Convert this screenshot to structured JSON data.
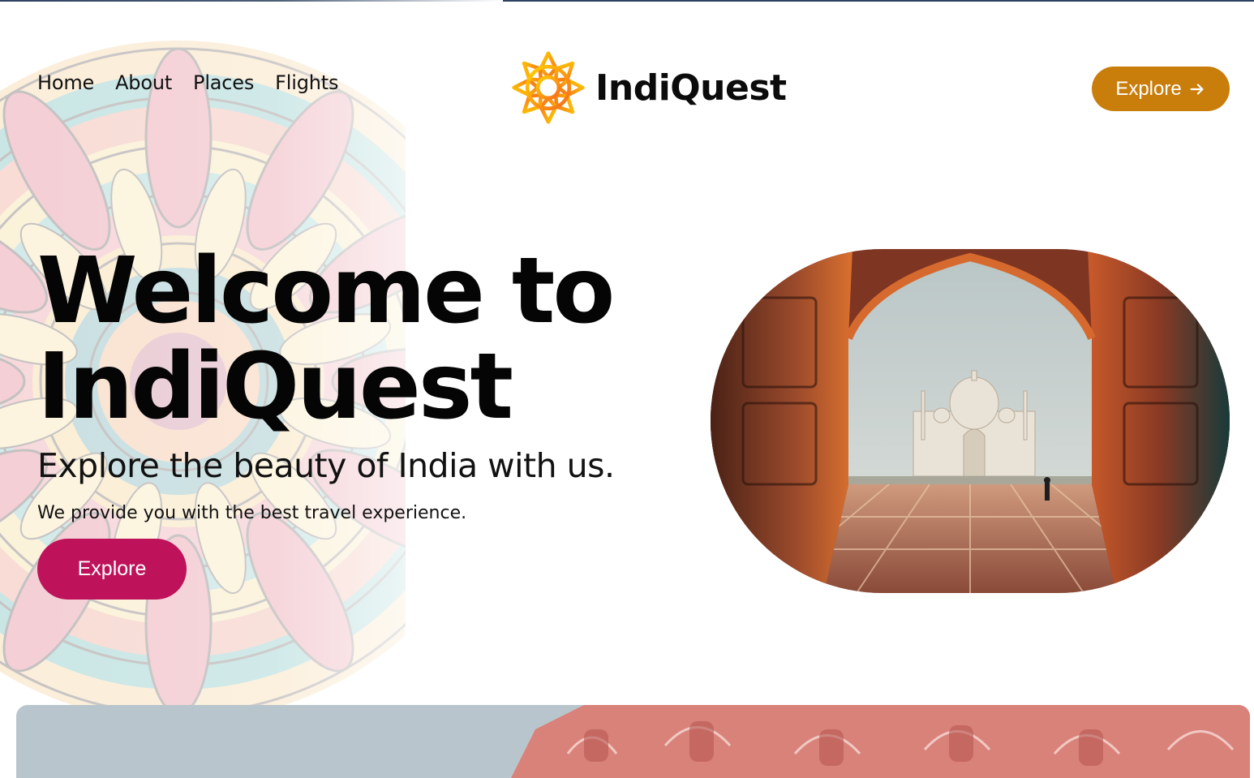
{
  "nav": {
    "items": [
      {
        "label": "Home"
      },
      {
        "label": "About"
      },
      {
        "label": "Places"
      },
      {
        "label": "Flights"
      }
    ]
  },
  "brand": {
    "name": "IndiQuest",
    "logo_icon": "lotus-mandala-icon"
  },
  "header_cta": {
    "label": "Explore",
    "icon": "arrow-right-icon"
  },
  "hero": {
    "title_line1": "Welcome to",
    "title_line2": "IndiQuest",
    "subtitle": "Explore the beauty of India with us.",
    "description": "We provide you with the best travel experience.",
    "cta_label": "Explore"
  },
  "colors": {
    "header_cta": "#c97d0b",
    "hero_cta": "#be135b",
    "logo_orange": "#f7941d",
    "logo_yellow": "#ffd000"
  }
}
